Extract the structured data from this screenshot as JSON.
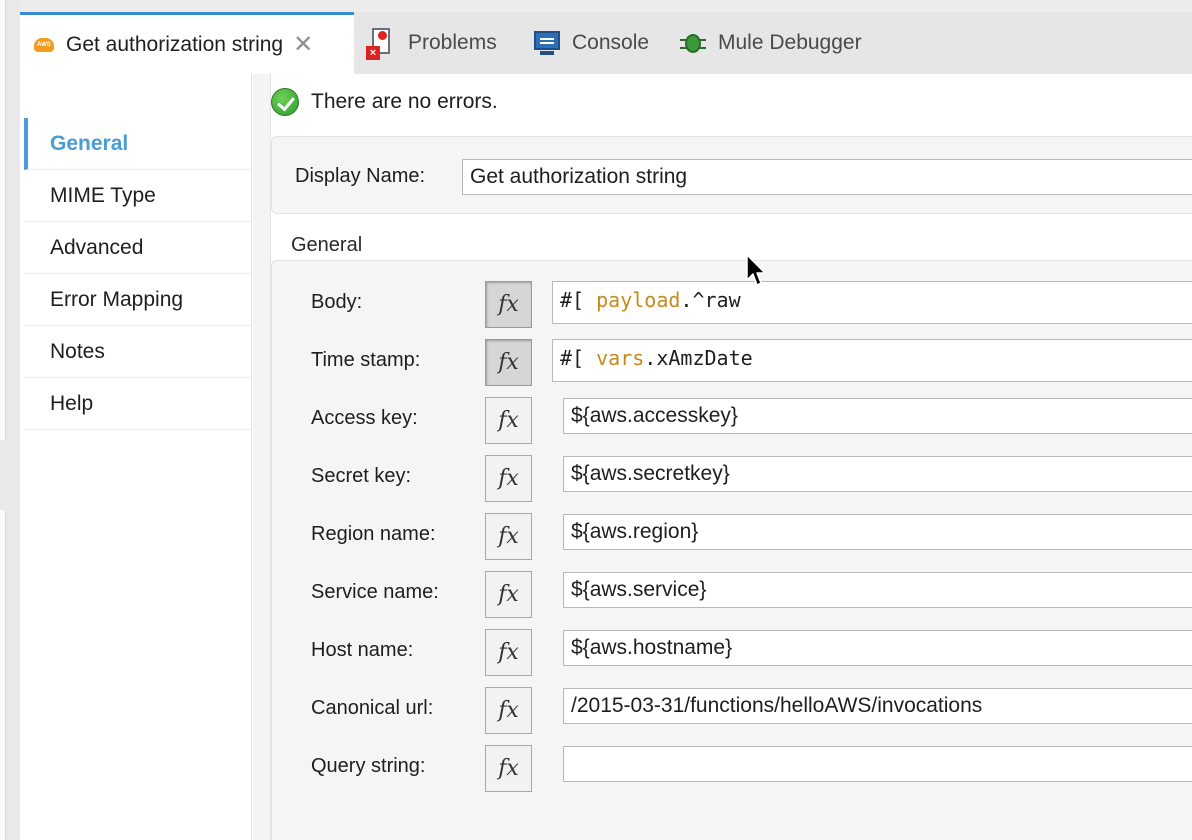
{
  "tabs": [
    {
      "label": "Get authorization string",
      "icon": "aws-icon",
      "close": "✕"
    },
    {
      "label": "Problems",
      "icon": "problems-icon"
    },
    {
      "label": "Console",
      "icon": "console-icon"
    },
    {
      "label": "Mule Debugger",
      "icon": "bug-icon"
    }
  ],
  "sidebar": {
    "items": [
      {
        "label": "General"
      },
      {
        "label": "MIME Type"
      },
      {
        "label": "Advanced"
      },
      {
        "label": "Error Mapping"
      },
      {
        "label": "Notes"
      },
      {
        "label": "Help"
      }
    ]
  },
  "status": {
    "message": "There are no errors."
  },
  "display_name": {
    "label": "Display Name:",
    "value": "Get authorization string"
  },
  "section": {
    "title": "General"
  },
  "fx_label": "fx",
  "fields": {
    "body": {
      "label": "Body:",
      "prefix": "#[ ",
      "keyword": "payload",
      "rest": ".^raw"
    },
    "timestamp": {
      "label": "Time stamp:",
      "prefix": "#[ ",
      "keyword": "vars",
      "rest": ".xAmzDate"
    },
    "access_key": {
      "label": "Access key:",
      "value": "${aws.accesskey}"
    },
    "secret_key": {
      "label": "Secret key:",
      "value": "${aws.secretkey}"
    },
    "region_name": {
      "label": "Region name:",
      "value": "${aws.region}"
    },
    "service_name": {
      "label": "Service name:",
      "value": "${aws.service}"
    },
    "host_name": {
      "label": "Host name:",
      "value": "${aws.hostname}"
    },
    "canonical_url": {
      "label": "Canonical url:",
      "value": "/2015-03-31/functions/helloAWS/invocations"
    },
    "query_string": {
      "label": "Query string:",
      "value": ""
    }
  },
  "colors": {
    "accent": "#4a9bd6",
    "keyword": "#c58a1b",
    "tab_indicator": "#3a8cd0"
  }
}
